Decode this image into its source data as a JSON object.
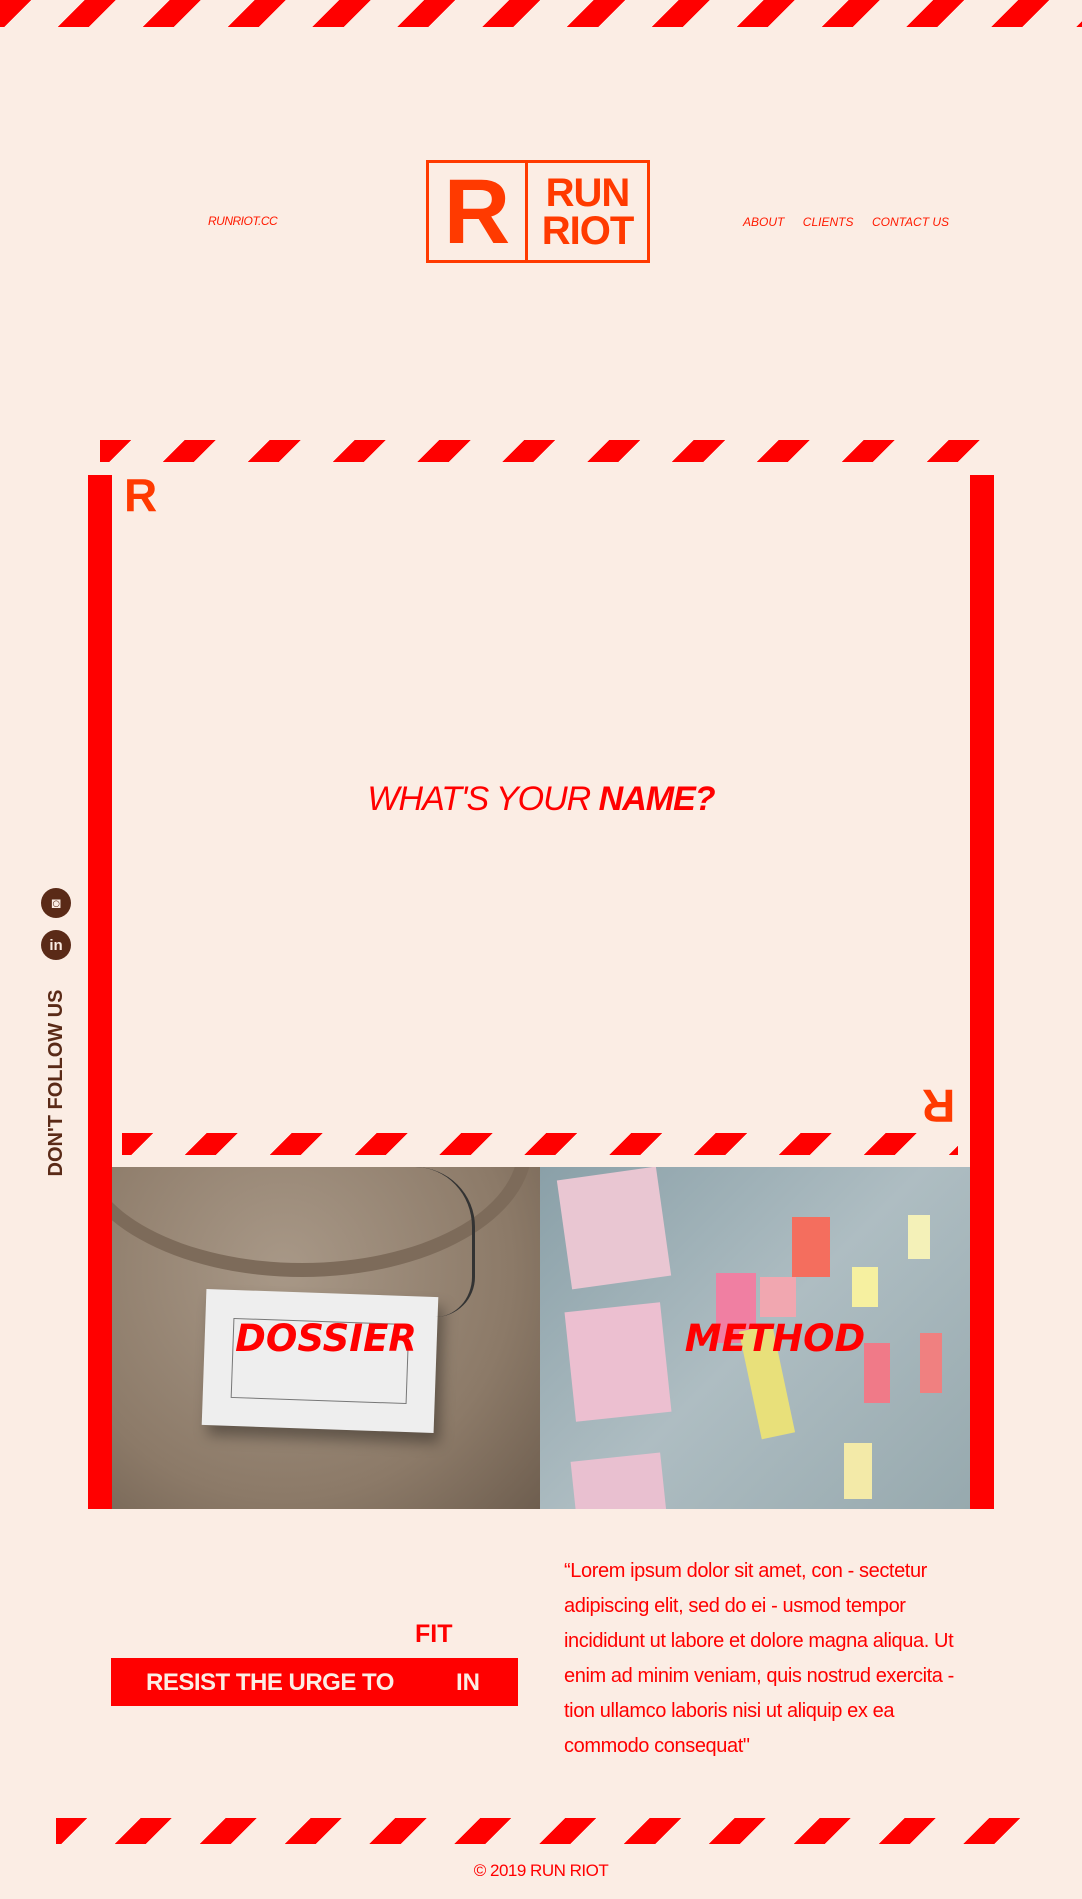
{
  "header": {
    "site_url": "RUNRIOT.CC",
    "logo_letter": "R",
    "logo_line1": "RUN",
    "logo_line2": "RIOT",
    "nav": [
      "ABOUT",
      "CLIENTS",
      "CONTACT US"
    ]
  },
  "hero": {
    "mark_letter": "R",
    "headline_light": "WHAT'S YOUR ",
    "headline_bold": "NAME?"
  },
  "sidebar": {
    "follow_text": "DON'T FOLLOW US",
    "icons": [
      "instagram-icon",
      "linkedin-icon"
    ],
    "instagram_glyph": "◙",
    "linkedin_glyph": "in"
  },
  "cards": [
    {
      "label": "DOSSIER"
    },
    {
      "label": "METHOD"
    }
  ],
  "resist": {
    "line_prefix": "RESIST THE URGE TO",
    "word_fit": "FIT",
    "word_in": "IN"
  },
  "quote": "“Lorem ipsum dolor sit amet, con - sectetur adipiscing elit, sed do ei - usmod tempor incididunt ut labore et dolore magna aliqua. Ut enim ad minim veniam, quis nostrud exercita - tion ullamco laboris nisi ut aliquip ex ea commodo consequat\"",
  "footer": {
    "copyright": "© 2019 RUN RIOT"
  },
  "colors": {
    "accent": "#ff0000",
    "logo": "#ff3a00",
    "background": "#fbede4",
    "dark_brown": "#5a2a17"
  }
}
